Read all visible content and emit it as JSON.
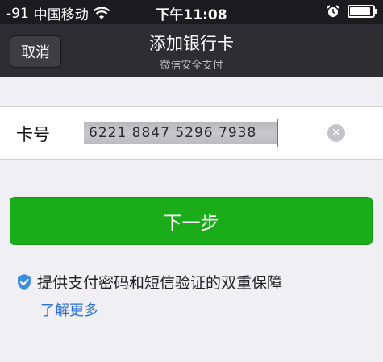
{
  "status_bar": {
    "signal": "-91",
    "carrier": "中国移动",
    "time": "下午11:08"
  },
  "nav": {
    "cancel_label": "取消",
    "title": "添加银行卡",
    "subtitle": "微信安全支付"
  },
  "card_form": {
    "label": "卡号",
    "value": "6221 8847 5296 7938"
  },
  "next_button_label": "下一步",
  "notice": {
    "text": "提供支付密码和短信验证的双重保障",
    "link": "了解更多"
  },
  "colors": {
    "primary_green": "#1aad19",
    "nav_bg": "#2d2d32",
    "link_blue": "#2c6ed6",
    "page_bg": "#efeff4"
  },
  "icons": [
    "wifi-icon",
    "alarm-clock-icon",
    "battery-icon",
    "clear-icon",
    "shield-check-icon"
  ],
  "battery_level": 0.9
}
